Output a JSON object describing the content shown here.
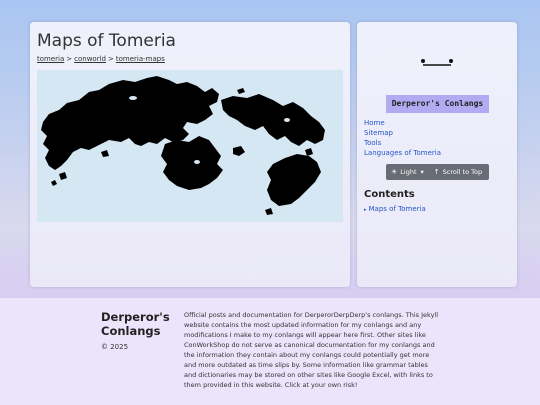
{
  "main": {
    "title": "Maps of Tomeria",
    "breadcrumb": [
      "tomeria",
      "conworld",
      "tomeria-maps"
    ],
    "breadcrumb_sep": ">"
  },
  "sidebar": {
    "brand": "Derperor's Conlangs",
    "nav": [
      "Home",
      "Sitemap",
      "Tools",
      "Languages of Tomeria"
    ],
    "theme_label": "Light",
    "theme_icon": "sun-icon",
    "theme_glyph": "☀",
    "dropdown_glyph": "▾",
    "scroll_label": "Scroll to Top",
    "scroll_glyph": "↑",
    "contents_title": "Contents",
    "toc": [
      "Maps of Tomeria"
    ],
    "toc_arrow": "▸"
  },
  "footer": {
    "name": "Derperor's Conlangs",
    "copyright": "© 2025",
    "description": "Official posts and documentation for DerperorDerpDerp's conlangs. This Jekyll website contains the most updated information for my conlangs and any modifications I make to my conlangs will appear here first. Other sites like ConWorkShop do not serve as canonical documentation for my conlangs and the information they contain about my conlangs could potentially get more and more outdated as time slips by. Some information like grammar tables and dictionaries may be stored on other sites like Google Excel, with links to them provided in this website. Click at your own risk!"
  },
  "colors": {
    "map_water": "#d5e7f3",
    "map_land": "#000000",
    "link": "#2554c7",
    "brand_badge": "#b3abf2"
  }
}
